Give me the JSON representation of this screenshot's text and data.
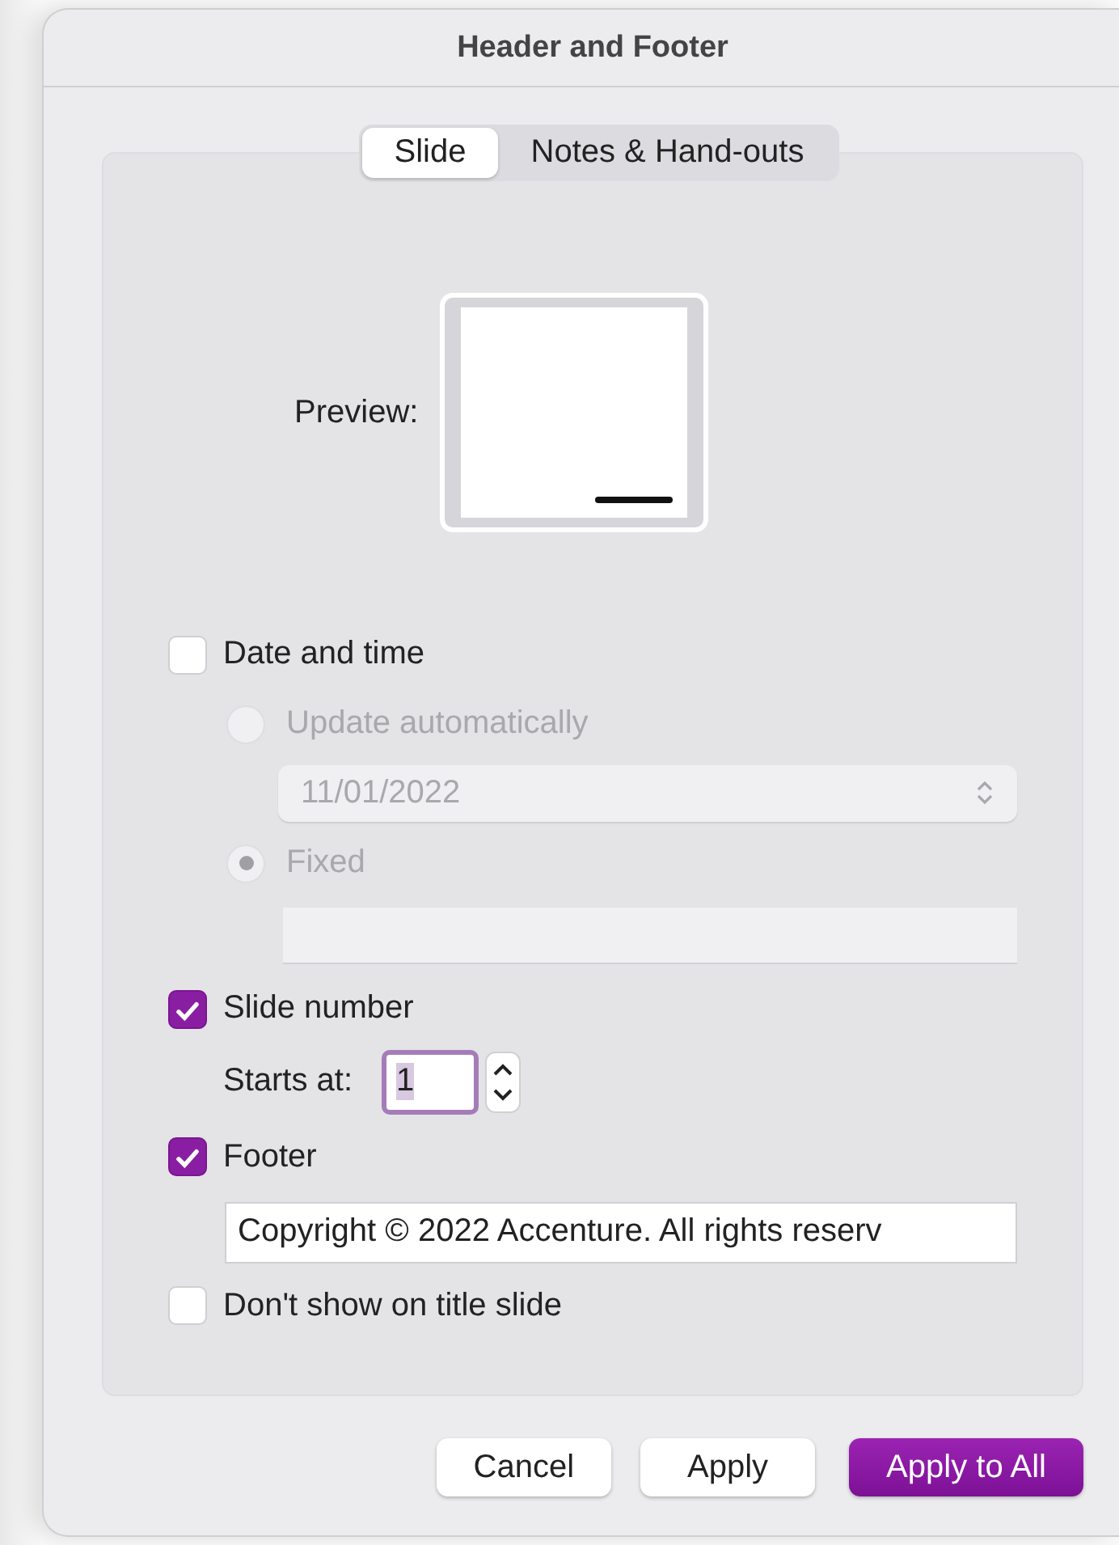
{
  "window": {
    "title": "Header and Footer"
  },
  "tabs": [
    {
      "label": "Slide",
      "selected": true
    },
    {
      "label": "Notes & Hand-outs",
      "selected": false
    }
  ],
  "preview": {
    "label": "Preview:"
  },
  "date_and_time": {
    "label": "Date and time",
    "checked": false,
    "update_automatically": {
      "label": "Update automatically",
      "selected": false
    },
    "date_select": {
      "value": "11/01/2022"
    },
    "fixed": {
      "label": "Fixed",
      "selected": true
    }
  },
  "slide_number": {
    "label": "Slide number",
    "checked": true,
    "starts_at": {
      "label": "Starts at:",
      "value": "1"
    }
  },
  "footer": {
    "label": "Footer",
    "checked": true,
    "value": "Copyright © 2022 Accenture. All rights reserv"
  },
  "dont_show_on_title_slide": {
    "label": "Don't show on title slide",
    "checked": false
  },
  "buttons": [
    {
      "label": "Cancel",
      "kind": "default"
    },
    {
      "label": "Apply",
      "kind": "default"
    },
    {
      "label": "Apply to All",
      "kind": "primary"
    }
  ]
}
